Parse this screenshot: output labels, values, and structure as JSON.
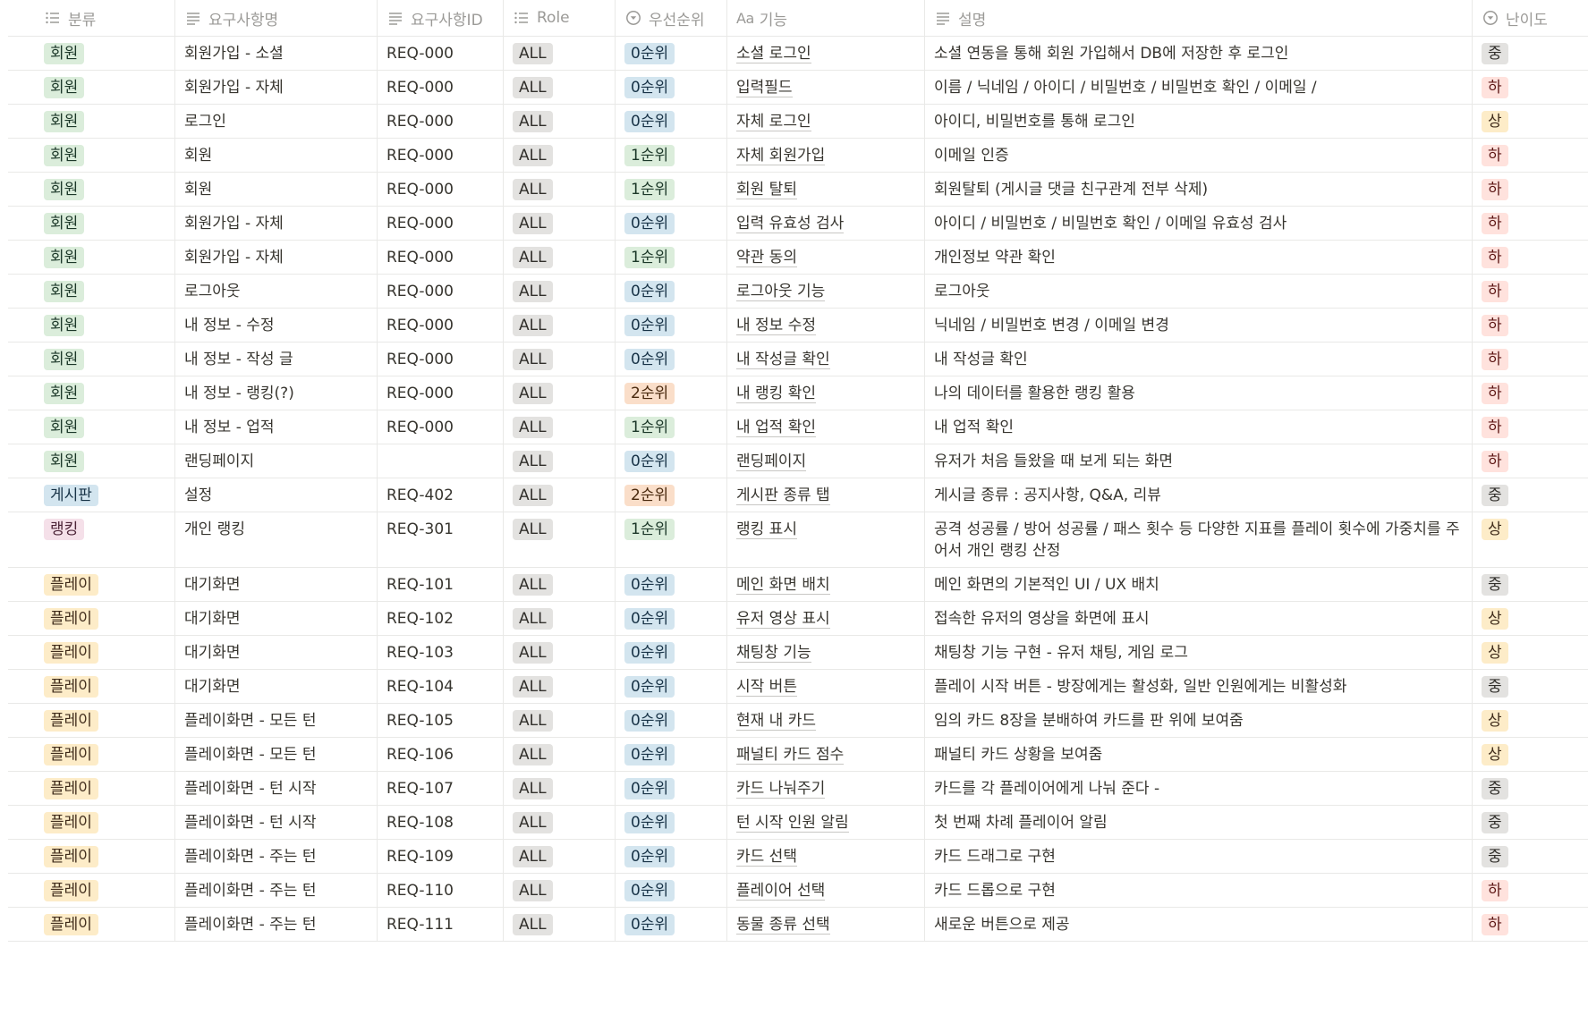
{
  "columns": [
    {
      "label": "분류",
      "icon": "list-icon"
    },
    {
      "label": "요구사항명",
      "icon": "text-lines-icon"
    },
    {
      "label": "요구사항ID",
      "icon": "text-lines-icon"
    },
    {
      "label": "Role",
      "icon": "list-icon"
    },
    {
      "label": "우선순위",
      "icon": "select-icon"
    },
    {
      "label": "기능",
      "icon": "title-aa-icon"
    },
    {
      "label": "설명",
      "icon": "text-lines-icon"
    },
    {
      "label": "난이도",
      "icon": "select-icon"
    }
  ],
  "tag_colors": {
    "회원": {
      "bg": "#dbeddb",
      "fg": "#1c3829"
    },
    "게시판": {
      "bg": "#d3e5ef",
      "fg": "#183347"
    },
    "랭킹": {
      "bg": "#f5e0e9",
      "fg": "#4c2337"
    },
    "플레이": {
      "bg": "#fdecc8",
      "fg": "#402c1b"
    },
    "0순위": {
      "bg": "#d3e5ef",
      "fg": "#183347"
    },
    "1순위": {
      "bg": "#dbeddb",
      "fg": "#1c3829"
    },
    "2순위": {
      "bg": "#fadec9",
      "fg": "#49290e"
    },
    "상": {
      "bg": "#fdecc8",
      "fg": "#402c1b"
    },
    "중": {
      "bg": "#e3e2e0",
      "fg": "#32302c"
    },
    "하": {
      "bg": "#ffe2dd",
      "fg": "#5d1715"
    }
  },
  "rows": [
    {
      "category": "회원",
      "name": "회원가입 - 소셜",
      "id": "REQ-000",
      "role": "ALL",
      "priority": "0순위",
      "feature": "소셜 로그인",
      "desc": "소셜 연동을 통해 회원 가입해서 DB에 저장한 후 로그인",
      "difficulty": "중"
    },
    {
      "category": "회원",
      "name": "회원가입 - 자체",
      "id": "REQ-000",
      "role": "ALL",
      "priority": "0순위",
      "feature": "입력필드",
      "desc": "이름 / 닉네임 / 아이디 / 비밀번호 / 비밀번호 확인 / 이메일 /",
      "difficulty": "하"
    },
    {
      "category": "회원",
      "name": "로그인",
      "id": "REQ-000",
      "role": "ALL",
      "priority": "0순위",
      "feature": "자체 로그인",
      "desc": " 아이디, 비밀번호를 통해 로그인",
      "difficulty": "상"
    },
    {
      "category": "회원",
      "name": "회원",
      "id": "REQ-000",
      "role": "ALL",
      "priority": "1순위",
      "feature": "자체 회원가입",
      "desc": "이메일 인증",
      "difficulty": "하"
    },
    {
      "category": "회원",
      "name": "회원",
      "id": "REQ-000",
      "role": "ALL",
      "priority": "1순위",
      "feature": "회원 탈퇴",
      "desc": "회원탈퇴  (게시글 댓글 친구관계 전부 삭제)",
      "difficulty": "하"
    },
    {
      "category": "회원",
      "name": "회원가입 - 자체",
      "id": "REQ-000",
      "role": "ALL",
      "priority": "0순위",
      "feature": "입력 유효성 검사",
      "desc": "아이디 / 비밀번호 / 비밀번호 확인 / 이메일 유효성 검사",
      "difficulty": "하"
    },
    {
      "category": "회원",
      "name": "회원가입 - 자체",
      "id": "REQ-000",
      "role": "ALL",
      "priority": "1순위",
      "feature": "약관 동의",
      "desc": "개인정보 약관 확인",
      "difficulty": "하"
    },
    {
      "category": "회원",
      "name": "로그아웃",
      "id": "REQ-000",
      "role": "ALL",
      "priority": "0순위",
      "feature": "로그아웃 기능",
      "desc": "로그아웃",
      "difficulty": "하"
    },
    {
      "category": "회원",
      "name": "내 정보 - 수정",
      "id": "REQ-000",
      "role": "ALL",
      "priority": "0순위",
      "feature": "내 정보 수정",
      "desc": "닉네임 / 비밀번호 변경 / 이메일 변경",
      "difficulty": "하"
    },
    {
      "category": "회원",
      "name": "내 정보 - 작성 글",
      "id": "REQ-000",
      "role": "ALL",
      "priority": "0순위",
      "feature": "내 작성글 확인",
      "desc": "내 작성글 확인",
      "difficulty": "하"
    },
    {
      "category": "회원",
      "name": "내 정보 - 랭킹(?)",
      "id": "REQ-000",
      "role": "ALL",
      "priority": "2순위",
      "feature": "내 랭킹 확인",
      "desc": "나의 데이터를 활용한 랭킹 활용",
      "difficulty": "하"
    },
    {
      "category": "회원",
      "name": "내 정보 - 업적",
      "id": "REQ-000",
      "role": "ALL",
      "priority": "1순위",
      "feature": "내 업적 확인",
      "desc": "내 업적 확인",
      "difficulty": "하"
    },
    {
      "category": "회원",
      "name": "랜딩페이지",
      "id": "",
      "role": "ALL",
      "priority": "0순위",
      "feature": "랜딩페이지",
      "desc": "유저가 처음 들왔을 때 보게 되는 화면",
      "difficulty": "하"
    },
    {
      "category": "게시판",
      "name": "설정",
      "id": "REQ-402",
      "role": "ALL",
      "priority": "2순위",
      "feature": "게시판 종류 탭",
      "desc": "게시글 종류 : 공지사항, Q&A, 리뷰",
      "difficulty": "중"
    },
    {
      "category": "랭킹",
      "name": "개인 랭킹",
      "id": "REQ-301",
      "role": "ALL",
      "priority": "1순위",
      "feature": "랭킹 표시",
      "desc": "공격 성공률  / 방어 성공률 / 패스 횟수  등 다양한 지표를 플레이 횟수에 가중치를 주어서 개인 랭킹 산정",
      "difficulty": "상"
    },
    {
      "category": "플레이",
      "name": "대기화면",
      "id": "REQ-101",
      "role": "ALL",
      "priority": "0순위",
      "feature": "메인 화면 배치",
      "desc": "메인 화면의 기본적인 UI / UX 배치",
      "difficulty": "중"
    },
    {
      "category": "플레이",
      "name": "대기화면",
      "id": "REQ-102",
      "role": "ALL",
      "priority": "0순위",
      "feature": "유저 영상 표시",
      "desc": "접속한 유저의 영상을 화면에 표시",
      "difficulty": "상"
    },
    {
      "category": "플레이",
      "name": "대기화면",
      "id": "REQ-103",
      "role": "ALL",
      "priority": "0순위",
      "feature": "채팅창 기능",
      "desc": "채팅창 기능 구현 - 유저 채팅, 게임 로그",
      "difficulty": "상"
    },
    {
      "category": "플레이",
      "name": "대기화면",
      "id": "REQ-104",
      "role": "ALL",
      "priority": "0순위",
      "feature": "시작 버튼",
      "desc": "플레이 시작 버튼 - 방장에게는 활성화, 일반 인원에게는 비활성화",
      "difficulty": "중"
    },
    {
      "category": "플레이",
      "name": "플레이화면 - 모든 턴",
      "id": "REQ-105",
      "role": "ALL",
      "priority": "0순위",
      "feature": "현재 내 카드",
      "desc": "임의 카드 8장을 분배하여 카드를 판 위에 보여줌",
      "difficulty": "상"
    },
    {
      "category": "플레이",
      "name": "플레이화면 - 모든 턴",
      "id": "REQ-106",
      "role": "ALL",
      "priority": "0순위",
      "feature": "패널티 카드 점수",
      "desc": "패널티 카드 상황을 보여줌",
      "difficulty": "상"
    },
    {
      "category": "플레이",
      "name": "플레이화면 - 턴 시작",
      "id": "REQ-107",
      "role": "ALL",
      "priority": "0순위",
      "feature": "카드 나눠주기",
      "desc": "카드를 각 플레이어에게 나눠 준다 -",
      "difficulty": "중"
    },
    {
      "category": "플레이",
      "name": "플레이화면 - 턴 시작",
      "id": "REQ-108",
      "role": "ALL",
      "priority": "0순위",
      "feature": "턴 시작 인원 알림",
      "desc": "첫 번째 차례 플레이어 알림",
      "difficulty": "중"
    },
    {
      "category": "플레이",
      "name": "플레이화면 - 주는 턴",
      "id": "REQ-109",
      "role": "ALL",
      "priority": "0순위",
      "feature": "카드 선택",
      "desc": "카드 드래그로 구현",
      "difficulty": "중"
    },
    {
      "category": "플레이",
      "name": "플레이화면 - 주는 턴",
      "id": "REQ-110",
      "role": "ALL",
      "priority": "0순위",
      "feature": "플레이어 선택",
      "desc": "카드 드롭으로 구현",
      "difficulty": "하"
    },
    {
      "category": "플레이",
      "name": "플레이화면 - 주는 턴",
      "id": "REQ-111",
      "role": "ALL",
      "priority": "0순위",
      "feature": "동물 종류 선택",
      "desc": "새로운 버튼으로 제공",
      "difficulty": "하"
    }
  ]
}
